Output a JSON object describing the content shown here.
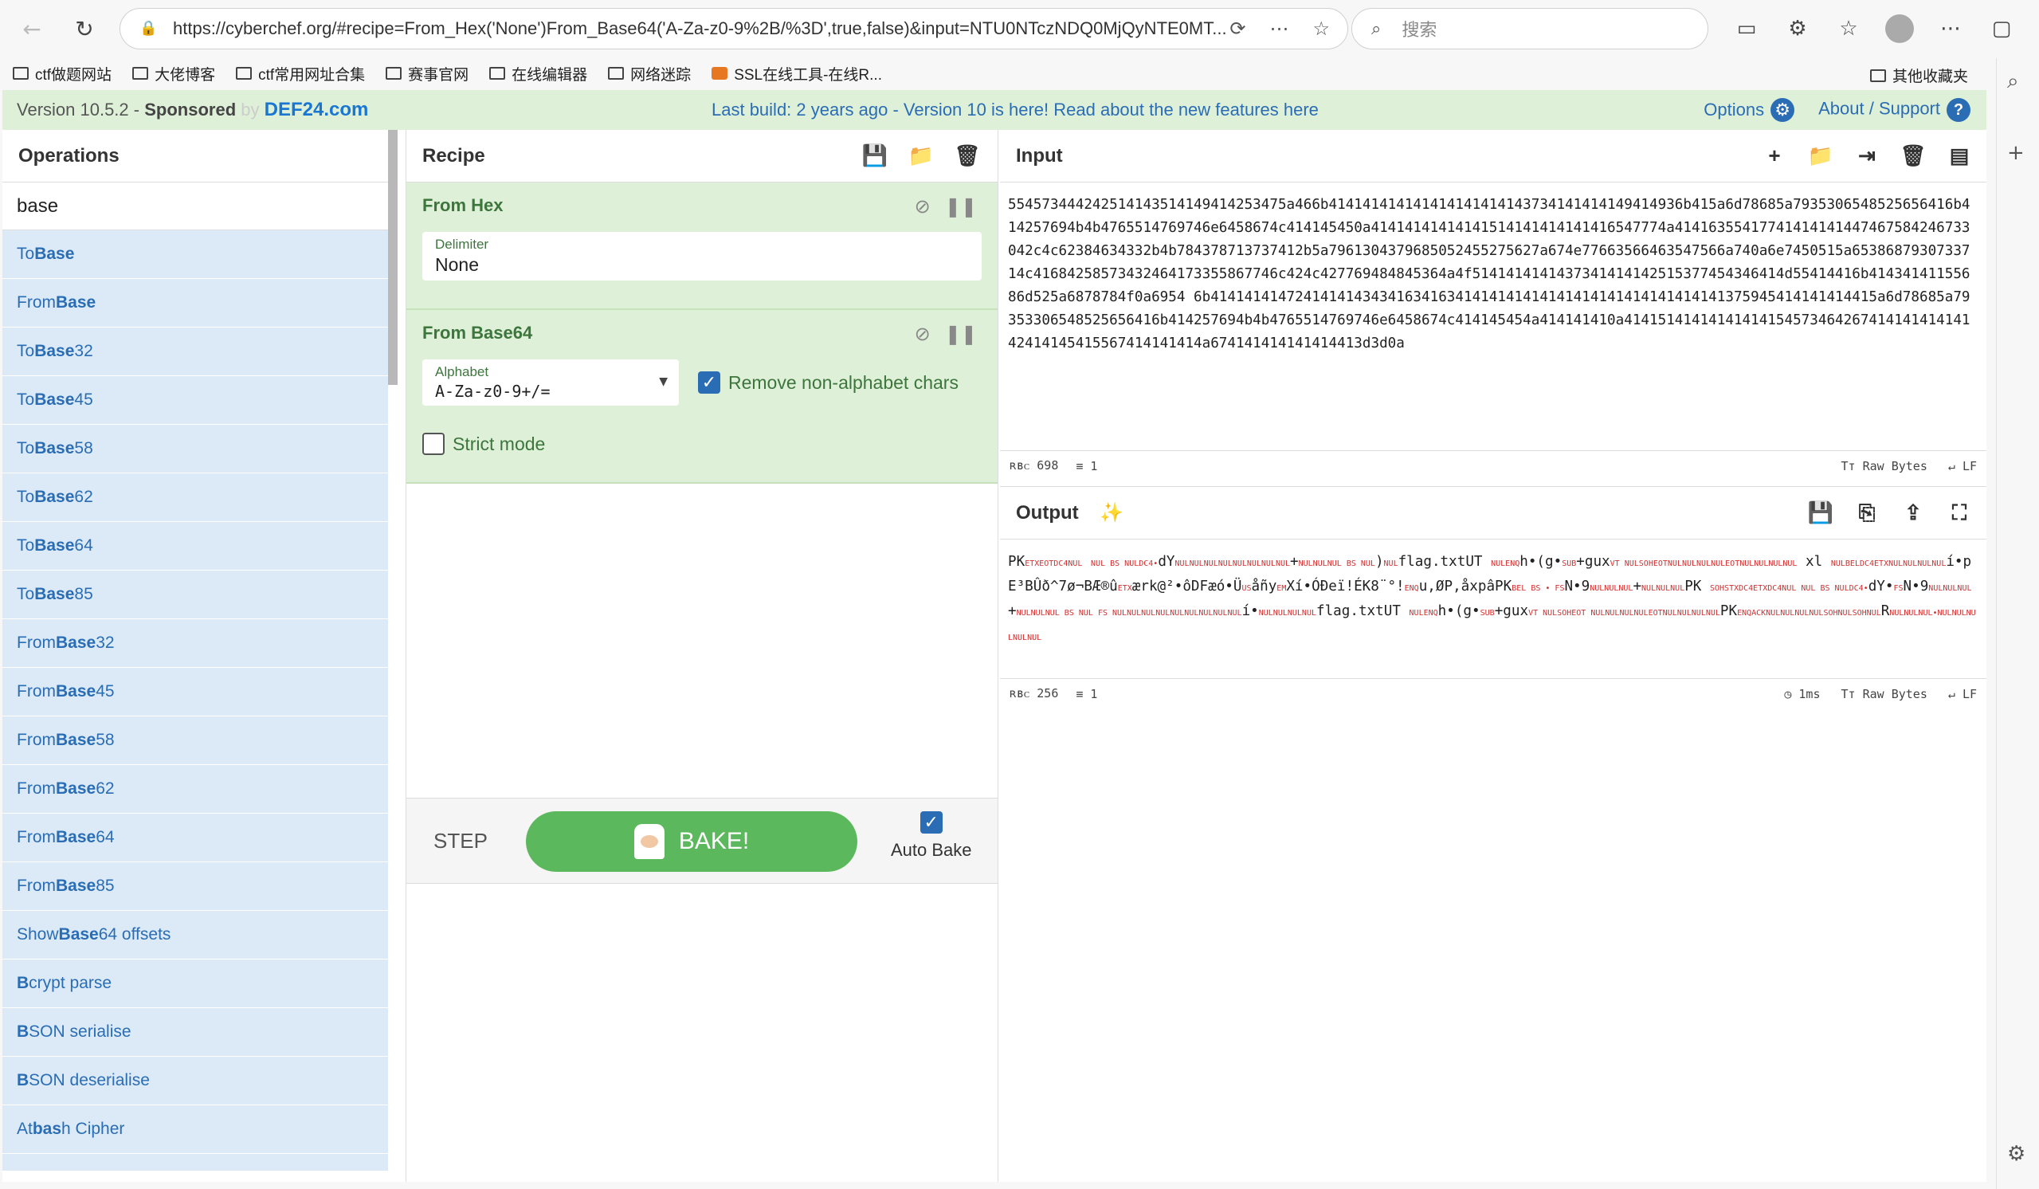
{
  "browser": {
    "url": "https://cyberchef.org/#recipe=From_Hex('None')From_Base64('A-Za-z0-9%2B/%3D',true,false)&input=NTU0NTczNDQ0MjQyNTE0MT...",
    "search_placeholder": "搜索",
    "bookmarks": [
      "ctf做题网站",
      "大佬博客",
      "ctf常用网址合集",
      "赛事官网",
      "在线编辑器",
      "网络迷踪",
      "SSL在线工具-在线R..."
    ],
    "bookmarks_right": "其他收藏夹"
  },
  "banner": {
    "version": "Version 10.5.2",
    "sponsored": "Sponsored by",
    "sponsor": "DEF24.com",
    "notice": "Last build: 2 years ago - Version 10 is here! Read about the new features here",
    "options": "Options",
    "about": "About / Support"
  },
  "operations": {
    "title": "Operations",
    "search": "base",
    "items": [
      {
        "pre": "To ",
        "hl": "Base",
        "post": ""
      },
      {
        "pre": "From ",
        "hl": "Base",
        "post": ""
      },
      {
        "pre": "To ",
        "hl": "Base",
        "post": "32"
      },
      {
        "pre": "To ",
        "hl": "Base",
        "post": "45"
      },
      {
        "pre": "To ",
        "hl": "Base",
        "post": "58"
      },
      {
        "pre": "To ",
        "hl": "Base",
        "post": "62"
      },
      {
        "pre": "To ",
        "hl": "Base",
        "post": "64"
      },
      {
        "pre": "To ",
        "hl": "Base",
        "post": "85"
      },
      {
        "pre": "From ",
        "hl": "Base",
        "post": "32"
      },
      {
        "pre": "From ",
        "hl": "Base",
        "post": "45"
      },
      {
        "pre": "From ",
        "hl": "Base",
        "post": "58"
      },
      {
        "pre": "From ",
        "hl": "Base",
        "post": "62"
      },
      {
        "pre": "From ",
        "hl": "Base",
        "post": "64"
      },
      {
        "pre": "From ",
        "hl": "Base",
        "post": "85"
      },
      {
        "pre": "Show ",
        "hl": "Base",
        "post": "64 offsets"
      },
      {
        "pre": "",
        "hl": "B",
        "post": "crypt parse"
      },
      {
        "pre": "",
        "hl": "B",
        "post": "SON serialise"
      },
      {
        "pre": "",
        "hl": "B",
        "post": "SON deserialise"
      },
      {
        "pre": "At",
        "hl": "bas",
        "post": "h Cipher"
      }
    ]
  },
  "recipe": {
    "title": "Recipe",
    "op1": {
      "title": "From Hex",
      "delimiter_label": "Delimiter",
      "delimiter_value": "None"
    },
    "op2": {
      "title": "From Base64",
      "alphabet_label": "Alphabet",
      "alphabet_value": "A-Za-z0-9+/=",
      "remove_label": "Remove non-alphabet chars",
      "strict_label": "Strict mode"
    },
    "step": "STEP",
    "bake": "BAKE!",
    "autobake": "Auto Bake"
  },
  "input": {
    "title": "Input",
    "text": "554573444242514143514149414253475a466b414141414141414141414143734141414149414936b415a6d78685a7935306548525656416b414257694b4b4765514769746e6458674c414145450a41414141414141514141414141416547774a41416355417741414141447467584246733042c4c62384634332b4b784378713737412b5a7961304379685052455275627a674e77663566463547566a740a6e7450515a6538687930733714c41684258573432464173355867746c424c427769484845364a4f5141414141437341414142515377454346414d55414416b41434141155686d525a6878784f0a6954 6b4141414147241414143434163416341414141414141414141414141414141375945414141414415a6d78685a79353306548525656416b414257694b4b4765514769746e6458674c414145454a414141410a4141514141414141415457346426741414141414142414145415567414141414a674141414141414413d3d0a",
    "chars": "698",
    "lines": "1",
    "raw": "Raw Bytes",
    "eol": "LF"
  },
  "output": {
    "title": "Output",
    "chars": "256",
    "lines": "1",
    "time": "1ms",
    "raw": "Raw Bytes",
    "eol": "LF"
  }
}
